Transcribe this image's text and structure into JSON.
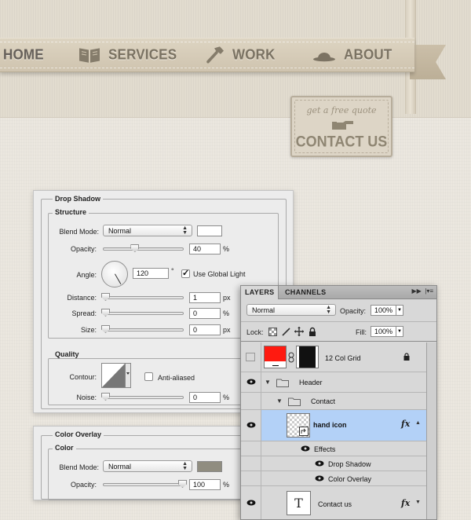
{
  "site": {
    "nav": [
      {
        "label": "HOME",
        "icon": "none"
      },
      {
        "label": "SERVICES",
        "icon": "book-icon"
      },
      {
        "label": "WORK",
        "icon": "hammer-icon"
      },
      {
        "label": "ABOUT",
        "icon": "bowler-hat-icon"
      }
    ],
    "quote": {
      "small": "get a free quote",
      "big": "CONTACT US",
      "icon": "pointing-hand-icon"
    }
  },
  "drop_shadow": {
    "title": "Drop Shadow",
    "structure": {
      "title": "Structure",
      "blend_mode_label": "Blend Mode:",
      "blend_mode_value": "Normal",
      "color": "#ffffff",
      "opacity_label": "Opacity:",
      "opacity_value": "40",
      "opacity_unit": "%",
      "opacity_level": 0.4,
      "angle_label": "Angle:",
      "angle_value": "120",
      "angle_unit": "°",
      "global_light_label": "Use Global Light",
      "global_light_checked": true,
      "distance_label": "Distance:",
      "distance_value": "1",
      "distance_unit": "px",
      "spread_label": "Spread:",
      "spread_value": "0",
      "spread_unit": "%",
      "size_label": "Size:",
      "size_value": "0",
      "size_unit": "px"
    },
    "quality": {
      "title": "Quality",
      "contour_label": "Contour:",
      "anti_aliased_label": "Anti-aliased",
      "anti_aliased_checked": false,
      "noise_label": "Noise:",
      "noise_value": "0",
      "noise_unit": "%"
    }
  },
  "color_overlay": {
    "title": "Color Overlay",
    "color_group": {
      "title": "Color",
      "blend_mode_label": "Blend Mode:",
      "blend_mode_value": "Normal",
      "color": "#908d80",
      "opacity_label": "Opacity:",
      "opacity_value": "100",
      "opacity_unit": "%",
      "opacity_level": 1.0
    }
  },
  "layers_panel": {
    "tabs": [
      "LAYERS",
      "CHANNELS"
    ],
    "blend_mode": "Normal",
    "opacity_label": "Opacity:",
    "opacity_value": "100%",
    "lock_label": "Lock:",
    "fill_label": "Fill:",
    "fill_value": "100%",
    "layers": {
      "grid": {
        "name": "12 Col Grid",
        "color": "#ff1a10"
      },
      "header": {
        "name": "Header"
      },
      "contact_group": {
        "name": "Contact"
      },
      "hand_icon": {
        "name": "hand icon",
        "fx": "fx"
      },
      "effects": {
        "name": "Effects"
      },
      "drop_shadow": {
        "name": "Drop Shadow"
      },
      "color_overlay": {
        "name": "Color Overlay"
      },
      "contact_text": {
        "name": "Contact us",
        "fx": "fx",
        "thumb": "T"
      }
    }
  }
}
